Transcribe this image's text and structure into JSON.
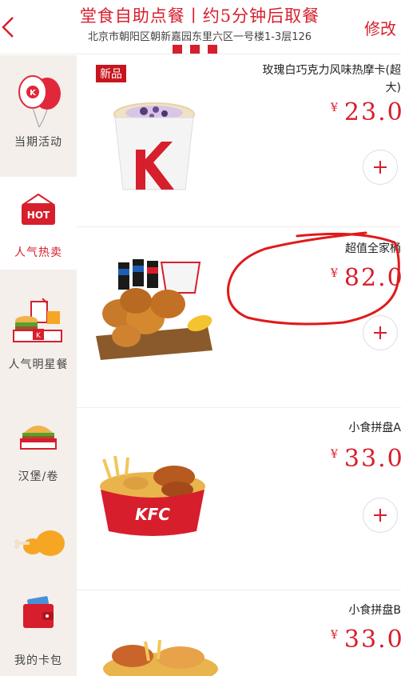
{
  "header": {
    "title": "堂食自助点餐丨约5分钟后取餐",
    "address": "北京市朝阳区朝新嘉园东里六区一号楼1-3层126",
    "modify_label": "修改"
  },
  "colors": {
    "brand_red": "#d71e2c",
    "sidebar_bg": "#f4efea"
  },
  "sidebar": {
    "categories": [
      {
        "label": "当期活动",
        "icon": "balloon-icon"
      },
      {
        "label": "人气热卖",
        "icon": "hot-basket-icon"
      },
      {
        "label": "人气明星餐",
        "icon": "meal-set-icon"
      },
      {
        "label": "汉堡/卷",
        "icon": "burger-icon"
      },
      {
        "label": "",
        "icon": "chicken-leg-icon"
      },
      {
        "label": "我的卡包",
        "icon": "wallet-icon"
      }
    ]
  },
  "products": [
    {
      "name_line1": "玫瑰白巧克力风味热摩卡(超",
      "name_line2": "大)",
      "currency": "¥",
      "price": "23.0",
      "badge": "新品",
      "image": "mocha-cup-image"
    },
    {
      "name_line1": "超值全家桶",
      "name_line2": "",
      "currency": "¥",
      "price": "82.0",
      "badge": "",
      "image": "family-bucket-image"
    },
    {
      "name_line1": "小食拼盘A",
      "name_line2": "",
      "currency": "¥",
      "price": "33.0",
      "badge": "",
      "image": "snack-platter-a-image"
    },
    {
      "name_line1": "小食拼盘B",
      "name_line2": "",
      "currency": "¥",
      "price": "33.0",
      "badge": "",
      "image": "snack-platter-b-image"
    }
  ],
  "annotation": {
    "type": "hand-drawn-circle",
    "color": "#e01a1a",
    "target": "超值全家桶"
  }
}
